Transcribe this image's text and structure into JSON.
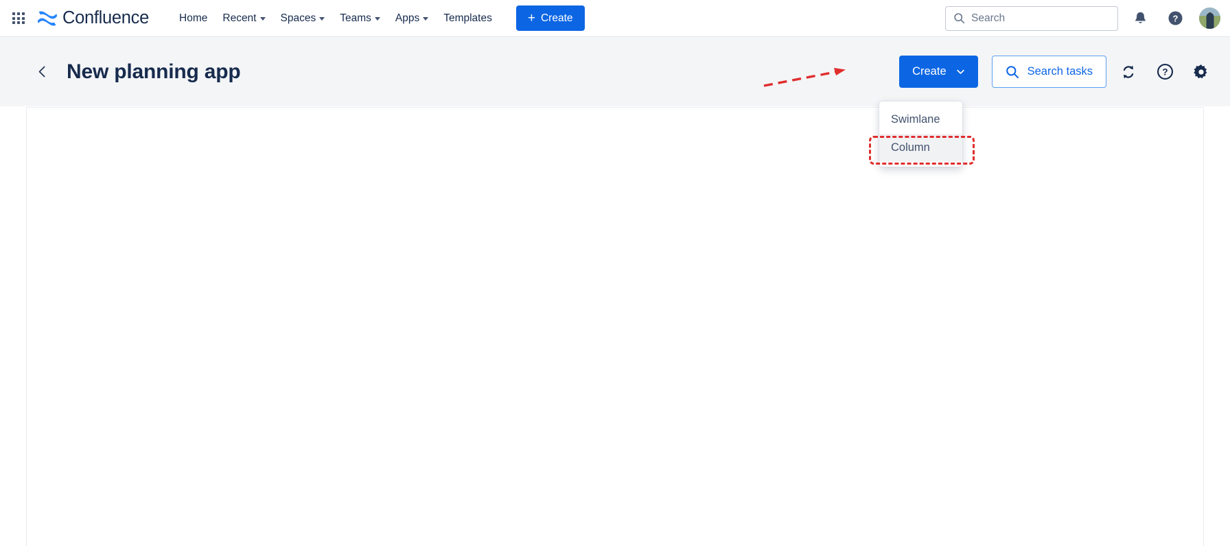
{
  "topnav": {
    "app_switcher": "app-switcher-grid",
    "brand": "Confluence",
    "links": [
      {
        "label": "Home",
        "has_caret": false
      },
      {
        "label": "Recent",
        "has_caret": true
      },
      {
        "label": "Spaces",
        "has_caret": true
      },
      {
        "label": "Teams",
        "has_caret": true
      },
      {
        "label": "Apps",
        "has_caret": true
      },
      {
        "label": "Templates",
        "has_caret": false
      }
    ],
    "create_label": "Create",
    "create_plus": "+",
    "create_color": "#0C66E4",
    "search_placeholder": "Search",
    "search_icon": "search-icon",
    "notification_icon": "bell-icon",
    "help_icon": "help-circle-icon",
    "avatar": "user-avatar"
  },
  "page_header": {
    "back_icon": "chevron-left-icon",
    "title": "New planning app",
    "create_label": "Create",
    "create_caret_icon": "chevron-down-icon",
    "search_tasks_label": "Search tasks",
    "search_tasks_icon": "search-icon",
    "search_tasks_color": "#0C66E4",
    "refresh_icon": "sync-refresh-icon",
    "help_icon": "help-circle-outline-icon",
    "settings_icon": "gear-icon",
    "background": "#F4F5F7"
  },
  "dropdown": {
    "open": true,
    "items": [
      {
        "label": "Swimlane",
        "hovered": false
      },
      {
        "label": "Column",
        "hovered": true
      }
    ]
  },
  "annotations": {
    "arrow_color": "#E02D2D",
    "box_color": "#E02D2D",
    "target_label": "Column"
  },
  "canvas": {
    "background": "#FFFFFF",
    "content": ""
  }
}
